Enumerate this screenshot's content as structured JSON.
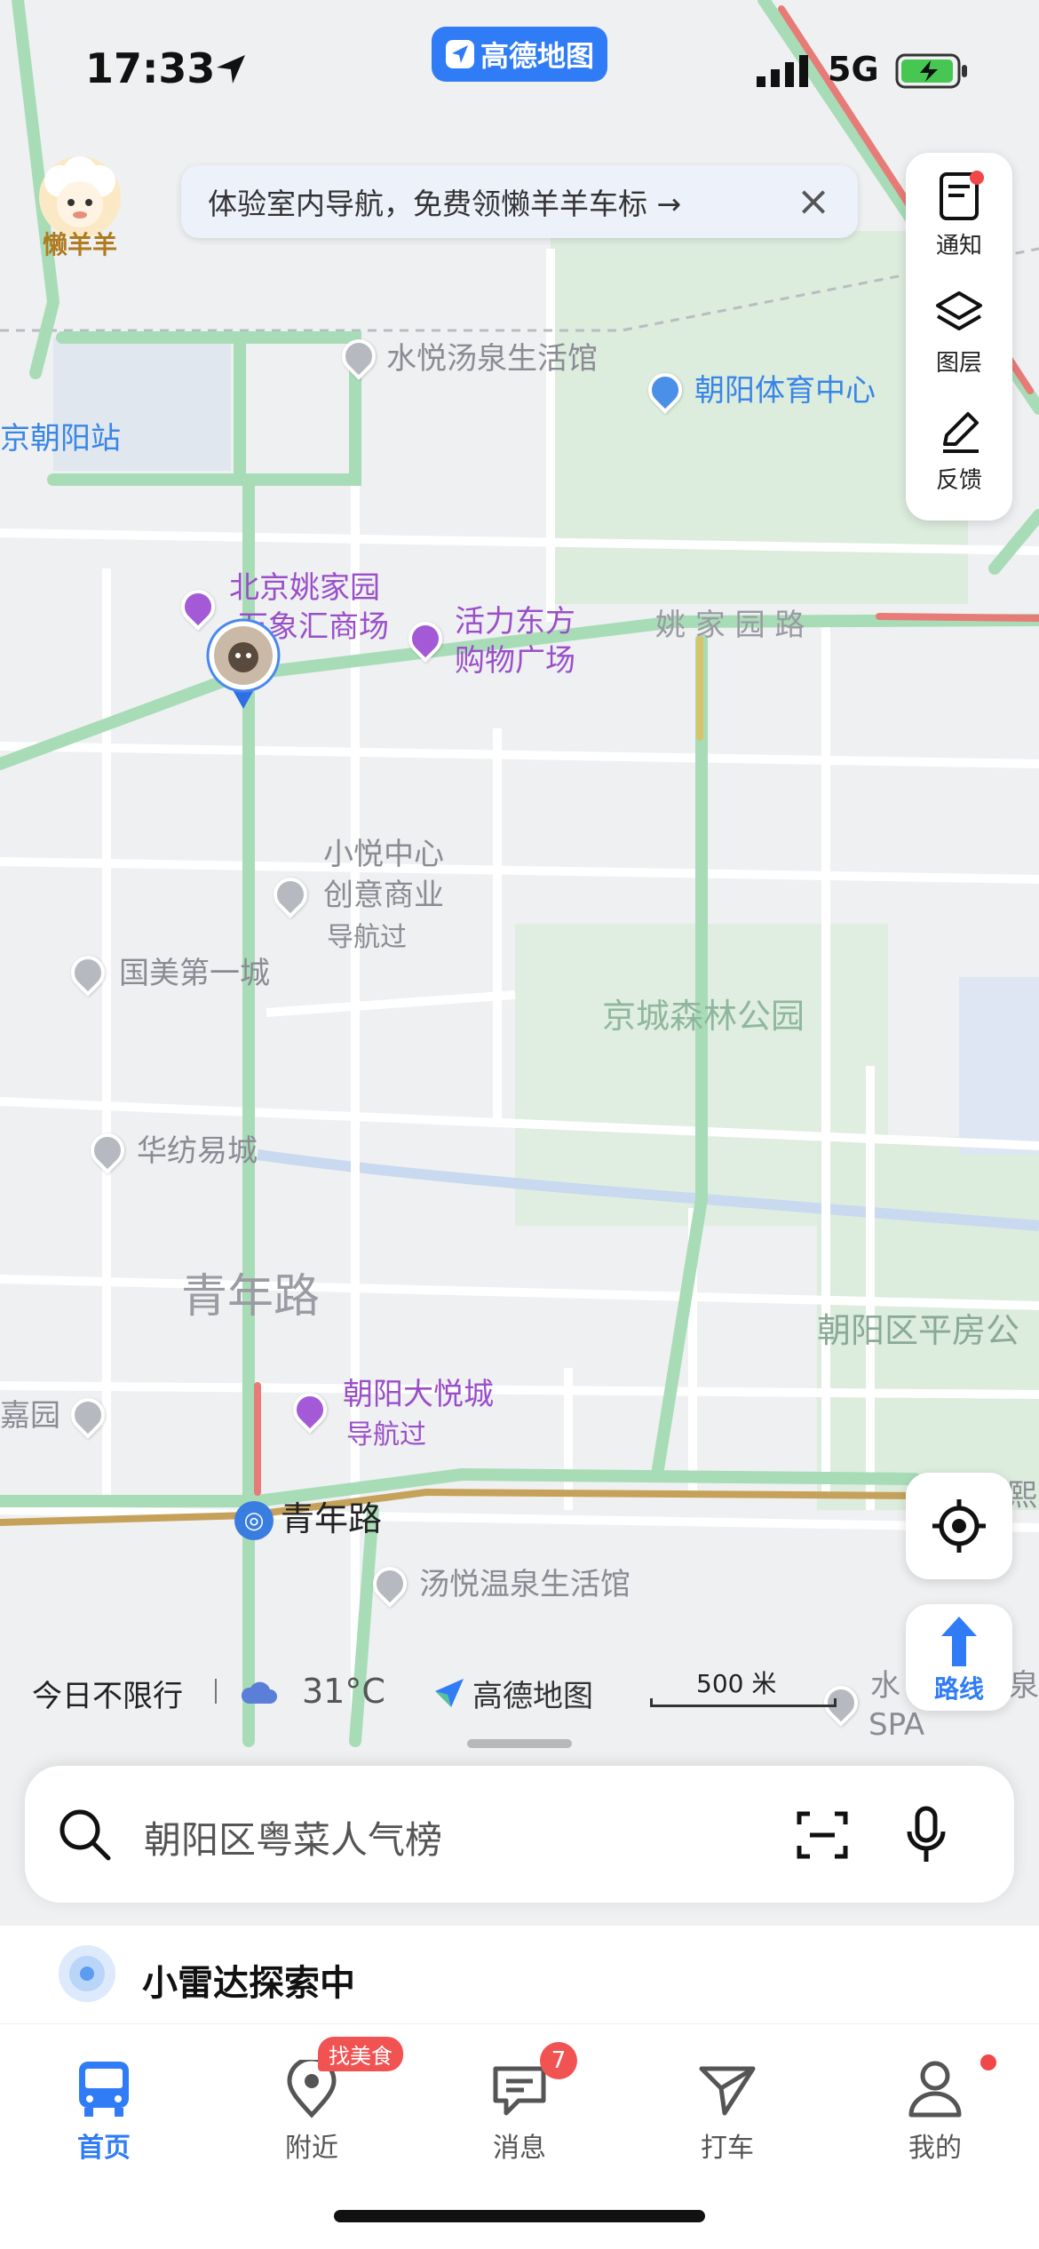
{
  "status_bar": {
    "time": "17:33",
    "network": "5G"
  },
  "app_pill": {
    "label": "高德地图"
  },
  "mascot": {
    "label": "懒羊羊"
  },
  "banner": {
    "text": "体验室内导航，免费领懒羊羊车标 →"
  },
  "side_tools": [
    {
      "label": "通知",
      "icon": "notification-icon"
    },
    {
      "label": "图层",
      "icon": "layers-icon"
    },
    {
      "label": "反馈",
      "icon": "feedback-icon"
    }
  ],
  "map_labels": {
    "shuiyue": "水悦汤泉生活馆",
    "chaoyang_sports": "朝阳体育中心",
    "chaoyang_station": "京朝阳站",
    "yaojiayuan_mall_1": "北京姚家园",
    "yaojiayuan_mall_2": "万象汇商场",
    "huoli_1": "活力东方",
    "huoli_2": "购物广场",
    "yaojiayuan_rd": "姚 家 园 路",
    "xiaoyue_1": "小悦中心",
    "xiaoyue_2": "创意商业",
    "xiaoyue_3": "导航过",
    "guomei": "国美第一城",
    "jingcheng_park": "京城森林公园",
    "huafang": "华纺易城",
    "qingnian_rd": "青年路",
    "pingfang": "朝阳区平房公",
    "joycity_1": "朝阳大悦城",
    "joycity_2": "导航过",
    "jiayuan": "嘉园",
    "qingnian_station": "青年路",
    "tangyue": "汤悦温泉生活馆",
    "shui_spa_1": "水",
    "shui_spa_2": "SPA",
    "right_edge": "熙",
    "right_edge_2": "泉"
  },
  "info_bar": {
    "restriction": "今日不限行",
    "temperature": "31°C",
    "brand": "高德地图",
    "scale": "500 米"
  },
  "route_button": {
    "label": "路线"
  },
  "search": {
    "placeholder": "朝阳区粤菜人气榜"
  },
  "radar": {
    "text": "小雷达探索中"
  },
  "tabs": [
    {
      "label": "首页",
      "icon": "bus-icon",
      "active": true
    },
    {
      "label": "附近",
      "icon": "location-pin-icon",
      "badge": "找美食"
    },
    {
      "label": "消息",
      "icon": "message-icon",
      "badge": "7"
    },
    {
      "label": "打车",
      "icon": "taxi-icon"
    },
    {
      "label": "我的",
      "icon": "profile-icon"
    }
  ]
}
